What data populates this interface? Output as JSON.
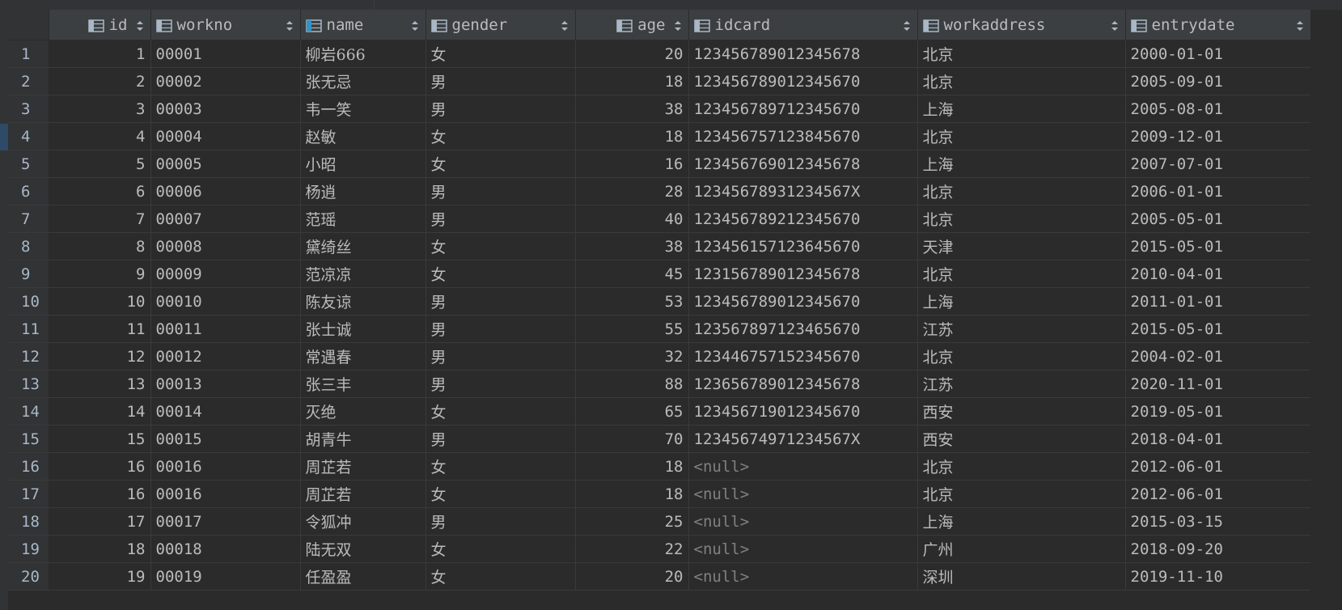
{
  "columns": [
    {
      "key": "id",
      "label": "id",
      "align": "right",
      "icon": "column-icon"
    },
    {
      "key": "workno",
      "label": "workno",
      "align": "left",
      "icon": "column-icon"
    },
    {
      "key": "name",
      "label": "name",
      "align": "left",
      "icon": "column-key-icon"
    },
    {
      "key": "gender",
      "label": "gender",
      "align": "left",
      "icon": "column-icon"
    },
    {
      "key": "age",
      "label": "age",
      "align": "right",
      "icon": "column-icon"
    },
    {
      "key": "idcard",
      "label": "idcard",
      "align": "left",
      "icon": "column-icon"
    },
    {
      "key": "workaddress",
      "label": "workaddress",
      "align": "left",
      "icon": "column-icon"
    },
    {
      "key": "entrydate",
      "label": "entrydate",
      "align": "left",
      "icon": "column-icon"
    }
  ],
  "rows": [
    {
      "n": "1",
      "id": "1",
      "workno": "00001",
      "name": "柳岩666",
      "gender": "女",
      "age": "20",
      "idcard": "123456789012345678",
      "workaddress": "北京",
      "entrydate": "2000-01-01"
    },
    {
      "n": "2",
      "id": "2",
      "workno": "00002",
      "name": "张无忌",
      "gender": "男",
      "age": "18",
      "idcard": "123456789012345670",
      "workaddress": "北京",
      "entrydate": "2005-09-01"
    },
    {
      "n": "3",
      "id": "3",
      "workno": "00003",
      "name": "韦一笑",
      "gender": "男",
      "age": "38",
      "idcard": "123456789712345670",
      "workaddress": "上海",
      "entrydate": "2005-08-01"
    },
    {
      "n": "4",
      "id": "4",
      "workno": "00004",
      "name": "赵敏",
      "gender": "女",
      "age": "18",
      "idcard": "123456757123845670",
      "workaddress": "北京",
      "entrydate": "2009-12-01"
    },
    {
      "n": "5",
      "id": "5",
      "workno": "00005",
      "name": "小昭",
      "gender": "女",
      "age": "16",
      "idcard": "123456769012345678",
      "workaddress": "上海",
      "entrydate": "2007-07-01"
    },
    {
      "n": "6",
      "id": "6",
      "workno": "00006",
      "name": "杨逍",
      "gender": "男",
      "age": "28",
      "idcard": "12345678931234567X",
      "workaddress": "北京",
      "entrydate": "2006-01-01"
    },
    {
      "n": "7",
      "id": "7",
      "workno": "00007",
      "name": "范瑶",
      "gender": "男",
      "age": "40",
      "idcard": "123456789212345670",
      "workaddress": "北京",
      "entrydate": "2005-05-01"
    },
    {
      "n": "8",
      "id": "8",
      "workno": "00008",
      "name": "黛绮丝",
      "gender": "女",
      "age": "38",
      "idcard": "123456157123645670",
      "workaddress": "天津",
      "entrydate": "2015-05-01"
    },
    {
      "n": "9",
      "id": "9",
      "workno": "00009",
      "name": "范凉凉",
      "gender": "女",
      "age": "45",
      "idcard": "123156789012345678",
      "workaddress": "北京",
      "entrydate": "2010-04-01"
    },
    {
      "n": "10",
      "id": "10",
      "workno": "00010",
      "name": "陈友谅",
      "gender": "男",
      "age": "53",
      "idcard": "123456789012345670",
      "workaddress": "上海",
      "entrydate": "2011-01-01"
    },
    {
      "n": "11",
      "id": "11",
      "workno": "00011",
      "name": "张士诚",
      "gender": "男",
      "age": "55",
      "idcard": "123567897123465670",
      "workaddress": "江苏",
      "entrydate": "2015-05-01"
    },
    {
      "n": "12",
      "id": "12",
      "workno": "00012",
      "name": "常遇春",
      "gender": "男",
      "age": "32",
      "idcard": "123446757152345670",
      "workaddress": "北京",
      "entrydate": "2004-02-01"
    },
    {
      "n": "13",
      "id": "13",
      "workno": "00013",
      "name": "张三丰",
      "gender": "男",
      "age": "88",
      "idcard": "123656789012345678",
      "workaddress": "江苏",
      "entrydate": "2020-11-01"
    },
    {
      "n": "14",
      "id": "14",
      "workno": "00014",
      "name": "灭绝",
      "gender": "女",
      "age": "65",
      "idcard": "123456719012345670",
      "workaddress": "西安",
      "entrydate": "2019-05-01"
    },
    {
      "n": "15",
      "id": "15",
      "workno": "00015",
      "name": "胡青牛",
      "gender": "男",
      "age": "70",
      "idcard": "12345674971234567X",
      "workaddress": "西安",
      "entrydate": "2018-04-01"
    },
    {
      "n": "16",
      "id": "16",
      "workno": "00016",
      "name": "周芷若",
      "gender": "女",
      "age": "18",
      "idcard": "<null>",
      "workaddress": "北京",
      "entrydate": "2012-06-01"
    },
    {
      "n": "17",
      "id": "16",
      "workno": "00016",
      "name": "周芷若",
      "gender": "女",
      "age": "18",
      "idcard": "<null>",
      "workaddress": "北京",
      "entrydate": "2012-06-01"
    },
    {
      "n": "18",
      "id": "17",
      "workno": "00017",
      "name": "令狐冲",
      "gender": "男",
      "age": "25",
      "idcard": "<null>",
      "workaddress": "上海",
      "entrydate": "2015-03-15"
    },
    {
      "n": "19",
      "id": "18",
      "workno": "00018",
      "name": "陆无双",
      "gender": "女",
      "age": "22",
      "idcard": "<null>",
      "workaddress": "广州",
      "entrydate": "2018-09-20"
    },
    {
      "n": "20",
      "id": "19",
      "workno": "00019",
      "name": "任盈盈",
      "gender": "女",
      "age": "20",
      "idcard": "<null>",
      "workaddress": "深圳",
      "entrydate": "2019-11-10"
    }
  ],
  "colors": {
    "background": "#2b2b2b",
    "header": "#3c3f41",
    "gutter": "#313335",
    "null_text": "#808080",
    "key_icon_accent": "#3592c4"
  }
}
